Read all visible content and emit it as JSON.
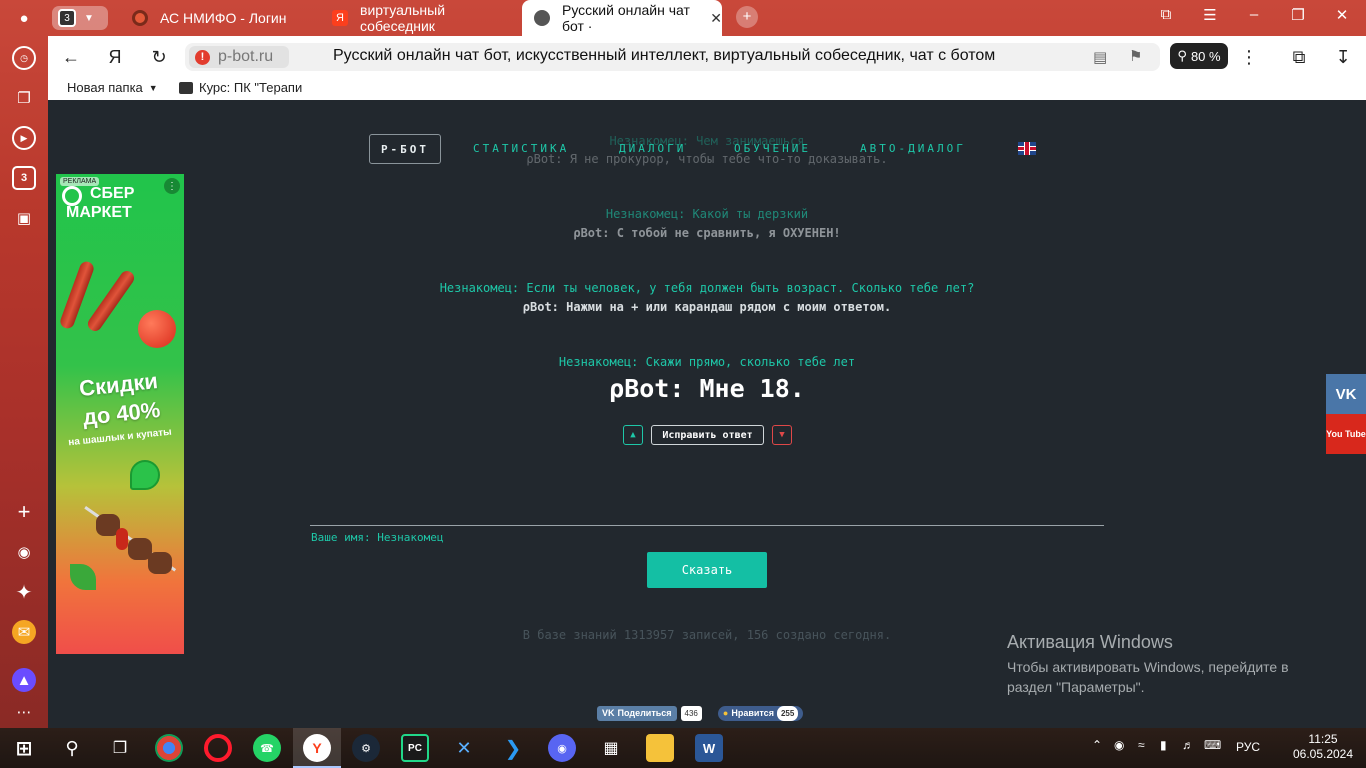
{
  "browser": {
    "tab_count": "3",
    "tabs": [
      {
        "label": "АС НМИФО - Логин"
      },
      {
        "label": "виртуальный собеседник"
      },
      {
        "label": "Русский онлайн чат бот ·"
      }
    ],
    "address": {
      "domain": "p-bot.ru",
      "title": "Русский онлайн чат бот, искусственный интеллект, виртуальный собеседник, чат с ботом"
    },
    "zoom": "80 %",
    "bookmarks": [
      {
        "label": "Новая папка"
      },
      {
        "label": "Курс: ПК \"Терапи"
      }
    ],
    "sidebar_badge": "3"
  },
  "page": {
    "nav": {
      "logo": "Р-БОТ",
      "links": [
        "СТАТИСТИКА",
        "ДИАЛОГИ",
        "ОБУЧЕНИЕ",
        "АВТО-ДИАЛОГ"
      ]
    },
    "chat": [
      {
        "user": "Незнакомец: Чем занимаешься",
        "bot": "ρBot: Я не прокурор, чтобы тебе что-то доказывать."
      },
      {
        "user": "Незнакомец: Какой ты дерзкий",
        "bot": "ρBot: С тобой не сравнить, я ОХУЕНЕН!"
      },
      {
        "user": "Незнакомец: Если ты человек, у тебя должен быть возраст. Сколько тебе лет?",
        "bot": "ρBot: Нажми на + или карандаш рядом с моим ответом."
      },
      {
        "user": "Незнакомец: Скажи прямо, сколько тебе лет",
        "bot": "ρBot: Мне 18."
      }
    ],
    "fix_button": "Исправить ответ",
    "name_label": "Ваше имя: Незнакомец",
    "say_button": "Сказать",
    "stats": "В базе знаний 1313957 записей, 156 создано сегодня.",
    "share": {
      "vk_label": "Поделиться",
      "vk_count": "436",
      "like_label": "Нравится",
      "like_count": "255"
    },
    "ad": {
      "badge": "РЕКЛАМА",
      "brand_line1": "СБЕР",
      "brand_line2": "МАРКЕТ",
      "promo_line1": "Скидки",
      "promo_line2": "до 40%",
      "promo_sub": "на шашлык и купаты"
    },
    "side_social": {
      "vk": "VK",
      "yt": "You Tube"
    }
  },
  "os": {
    "activation_title": "Активация Windows",
    "activation_text": "Чтобы активировать Windows, перейдите в раздел \"Параметры\".",
    "lang": "РУС",
    "time": "11:25",
    "date": "06.05.2024"
  },
  "colors": {
    "accent": "#1ec7a8",
    "page_bg": "#22282e",
    "browser_chrome": "#c9483a"
  }
}
